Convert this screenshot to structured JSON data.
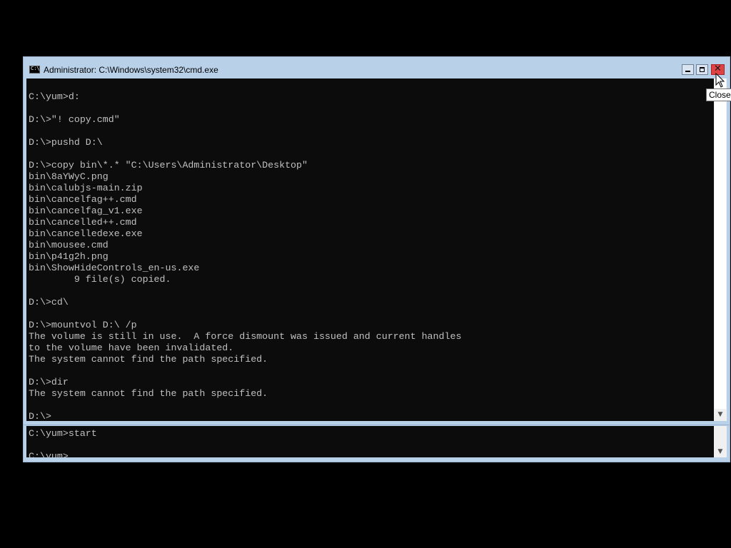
{
  "window": {
    "title": "Administrator: C:\\Windows\\system32\\cmd.exe",
    "icon": "cmd-icon",
    "icon_text": "C:\\",
    "buttons": {
      "minimize": "minimize-icon",
      "maximize": "maximize-icon",
      "close": "close-icon",
      "close_glyph": "✕"
    }
  },
  "console_front": {
    "text": "\nC:\\yum>d:\n\nD:\\>\"! copy.cmd\"\n\nD:\\>pushd D:\\\n\nD:\\>copy bin\\*.* \"C:\\Users\\Administrator\\Desktop\"\nbin\\8aYWyC.png\nbin\\calubjs-main.zip\nbin\\cancelfag++.cmd\nbin\\cancelfag_v1.exe\nbin\\cancelled++.cmd\nbin\\cancelledexe.exe\nbin\\mousee.cmd\nbin\\p41g2h.png\nbin\\ShowHideControls_en-us.exe\n        9 file(s) copied.\n\nD:\\>cd\\\n\nD:\\>mountvol D:\\ /p\nThe volume is still in use.  A force dismount was issued and current handles\nto the volume have been invalidated.\nThe system cannot find the path specified.\n\nD:\\>dir\nThe system cannot find the path specified.\n\nD:\\>"
  },
  "console_back": {
    "text": "C:\\yum>start\n\nC:\\yum>"
  },
  "tooltip": {
    "text": "Close"
  },
  "scrollbar": {
    "down_arrow": "▼"
  },
  "colors": {
    "console_bg": "#0c0c0c",
    "console_fg": "#c0c0c0",
    "frame": "#b8d0e8",
    "close_button": "#e04343"
  }
}
